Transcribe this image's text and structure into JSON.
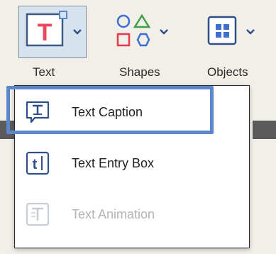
{
  "toolbar": {
    "text_label": "Text",
    "shapes_label": "Shapes",
    "objects_label": "Objects"
  },
  "menu": {
    "items": [
      {
        "label": "Text Caption",
        "icon": "text-caption-icon",
        "enabled": true,
        "highlighted": true
      },
      {
        "label": "Text Entry Box",
        "icon": "text-entry-box-icon",
        "enabled": true,
        "highlighted": false
      },
      {
        "label": "Text Animation",
        "icon": "text-animation-icon",
        "enabled": false,
        "highlighted": false
      }
    ]
  },
  "colors": {
    "text_icon_red": "#e64a5c",
    "shapes_green": "#43a047",
    "shapes_red": "#e53950",
    "shapes_blue": "#3b6fd0",
    "objects_blue": "#3b6fd0",
    "highlight_border": "#5b86c9",
    "menu_icon_blue": "#2f4f8a"
  }
}
